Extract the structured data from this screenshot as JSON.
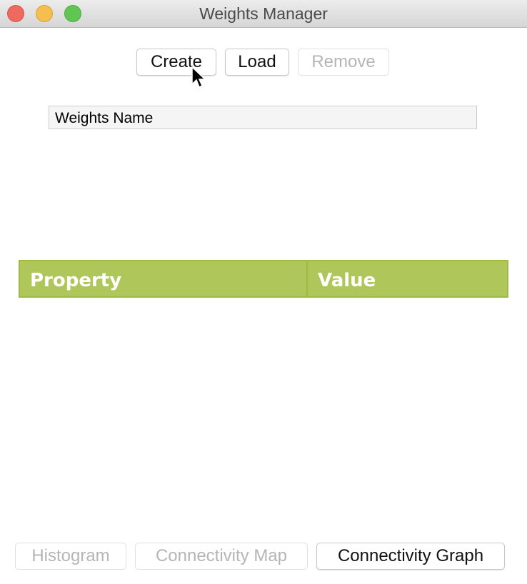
{
  "window": {
    "title": "Weights Manager"
  },
  "toolbar": {
    "create": "Create",
    "load": "Load",
    "remove": "Remove"
  },
  "weights_list": {
    "header": "Weights Name"
  },
  "properties_table": {
    "columns": [
      "Property",
      "Value"
    ]
  },
  "footer": {
    "histogram": "Histogram",
    "connectivity_map": "Connectivity Map",
    "connectivity_graph": "Connectivity Graph"
  },
  "colors": {
    "table_header": "#afc75a"
  }
}
